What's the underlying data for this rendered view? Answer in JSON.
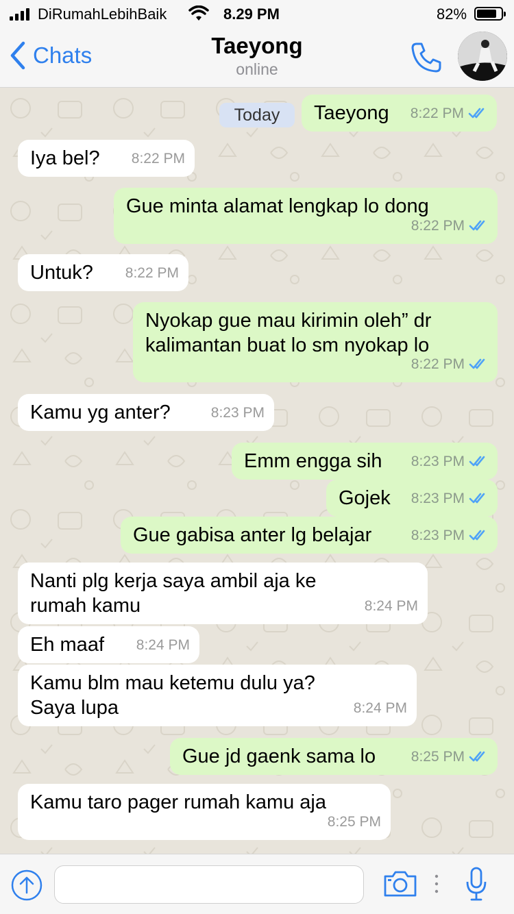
{
  "status_bar": {
    "carrier": "DiRumahLebihBaik",
    "time": "8.29 PM",
    "battery_percent": "82%",
    "battery_level": 0.82
  },
  "header": {
    "back_label": "Chats",
    "contact_name": "Taeyong",
    "contact_status": "online"
  },
  "date_divider": "Today",
  "messages": [
    {
      "dir": "out",
      "text": "Taeyong",
      "time": "8:22 PM"
    },
    {
      "dir": "in",
      "text": "Iya bel?",
      "time": "8:22 PM"
    },
    {
      "dir": "out",
      "text": "Gue minta alamat lengkap lo dong",
      "time": "8:22 PM"
    },
    {
      "dir": "in",
      "text": "Untuk?",
      "time": "8:22 PM"
    },
    {
      "dir": "out",
      "text": "Nyokap gue mau kirimin oleh” dr\nkalimantan buat lo sm nyokap lo",
      "time": "8:22 PM"
    },
    {
      "dir": "in",
      "text": "Kamu yg anter?",
      "time": "8:23 PM"
    },
    {
      "dir": "out",
      "text": "Emm engga sih",
      "time": "8:23 PM"
    },
    {
      "dir": "out",
      "text": "Gojek",
      "time": "8:23 PM"
    },
    {
      "dir": "out",
      "text": "Gue gabisa anter lg belajar",
      "time": "8:23 PM"
    },
    {
      "dir": "in",
      "text": "Nanti plg kerja saya ambil aja ke\nrumah kamu",
      "time": "8:24 PM"
    },
    {
      "dir": "in",
      "text": "Eh maaf",
      "time": "8:24 PM"
    },
    {
      "dir": "in",
      "text": "Kamu blm mau ketemu dulu ya?\nSaya lupa",
      "time": "8:24 PM"
    },
    {
      "dir": "out",
      "text": "Gue jd gaenk sama lo",
      "time": "8:25 PM"
    },
    {
      "dir": "in",
      "text": "Kamu taro pager rumah kamu aja",
      "time": "8:25 PM"
    }
  ],
  "input": {
    "placeholder": "",
    "value": ""
  },
  "colors": {
    "accent": "#2f80ed",
    "outgoing_bubble": "#dcf8c6",
    "incoming_bubble": "#ffffff",
    "read_ticks": "#4fa3f7",
    "chat_background": "#e8e4db"
  },
  "icons": {
    "back": "chevron-left-icon",
    "call": "phone-icon",
    "attach": "arrow-up-circle-icon",
    "camera": "camera-icon",
    "mic": "microphone-icon",
    "read": "double-check-icon"
  }
}
